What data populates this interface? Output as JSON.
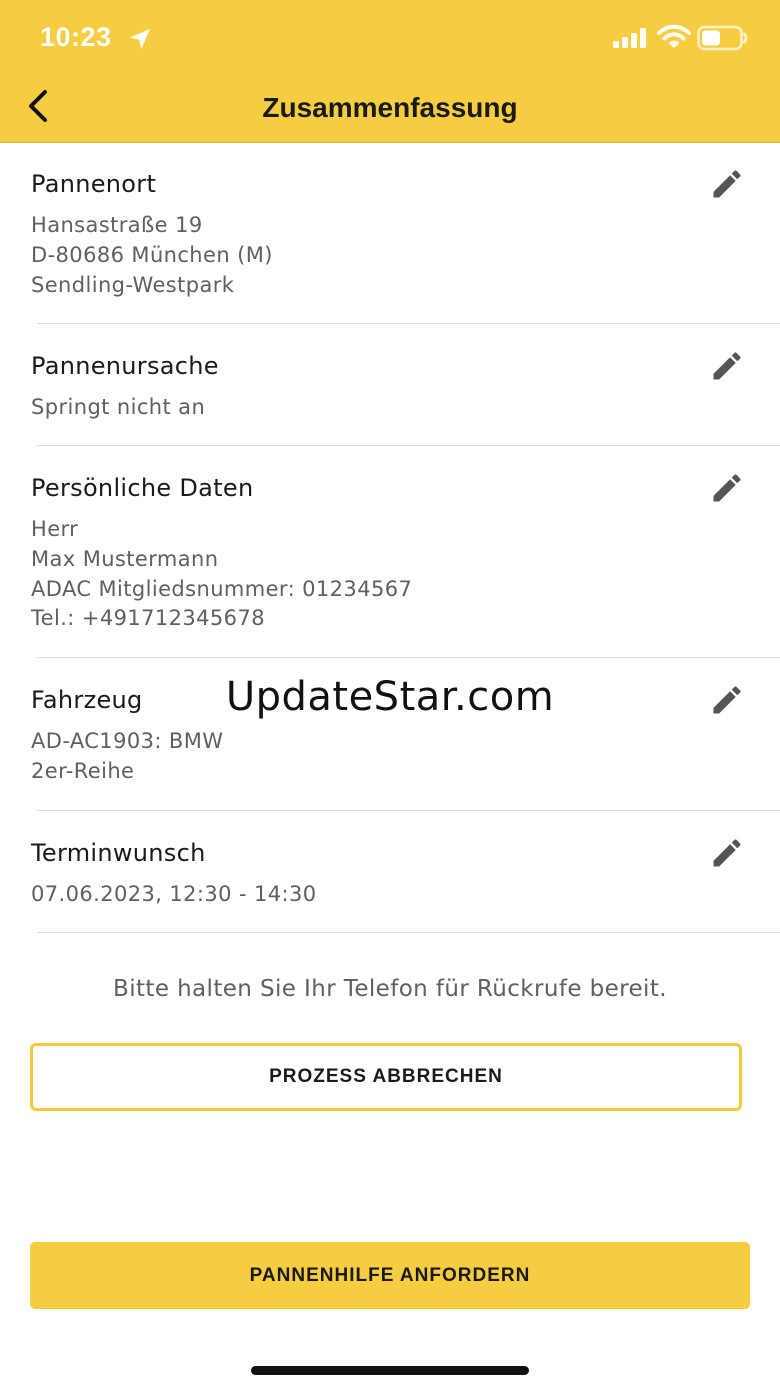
{
  "status_bar": {
    "time": "10:23",
    "location_icon": "location-arrow-icon",
    "signal_icon": "cellular-signal-icon",
    "wifi_icon": "wifi-icon",
    "battery_icon": "battery-icon"
  },
  "header": {
    "back_icon": "chevron-left-icon",
    "title": "Zusammenfassung",
    "background_color": "#f6cc41"
  },
  "sections": [
    {
      "title": "Pannenort",
      "lines": [
        "Hansastraße 19",
        "D-80686 München (M)",
        "Sendling-Westpark"
      ],
      "edit_icon": "pencil-icon"
    },
    {
      "title": "Pannenursache",
      "lines": [
        "Springt nicht an"
      ],
      "edit_icon": "pencil-icon"
    },
    {
      "title": "Persönliche Daten",
      "lines": [
        "Herr",
        "Max Mustermann",
        "ADAC Mitgliedsnummer: 01234567",
        "Tel.: +491712345678"
      ],
      "edit_icon": "pencil-icon"
    },
    {
      "title": "Fahrzeug",
      "lines": [
        "AD-AC1903: BMW",
        "2er-Reihe"
      ],
      "edit_icon": "pencil-icon"
    },
    {
      "title": "Terminwunsch",
      "lines": [
        "07.06.2023, 12:30 - 14:30"
      ],
      "edit_icon": "pencil-icon"
    }
  ],
  "watermark": "UpdateStar.com",
  "hint": "Bitte halten Sie Ihr Telefon für Rückrufe bereit.",
  "buttons": {
    "cancel_label": "PROZESS ABBRECHEN",
    "request_label": "PANNENHILFE ANFORDERN"
  },
  "colors": {
    "accent": "#f6cc41",
    "text_primary": "#1a1a1a",
    "text_secondary": "#5f5f5f"
  }
}
